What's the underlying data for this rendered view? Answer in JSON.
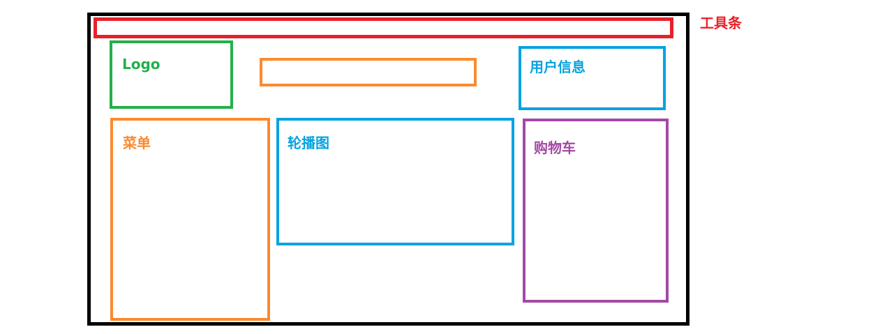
{
  "diagram": {
    "toolbar": {
      "label": "工具条",
      "color": "#e8202a"
    },
    "logo": {
      "label": "Logo",
      "color": "#22b04b"
    },
    "search_box": {
      "color": "#fb8a2e"
    },
    "user_info": {
      "label": "用户信息",
      "color": "#07a3e0"
    },
    "menu": {
      "label": "菜单",
      "color": "#fb8a2e"
    },
    "carousel": {
      "label": "轮播图",
      "color": "#07a3e0"
    },
    "cart": {
      "label": "购物车",
      "color": "#a349a4"
    }
  }
}
